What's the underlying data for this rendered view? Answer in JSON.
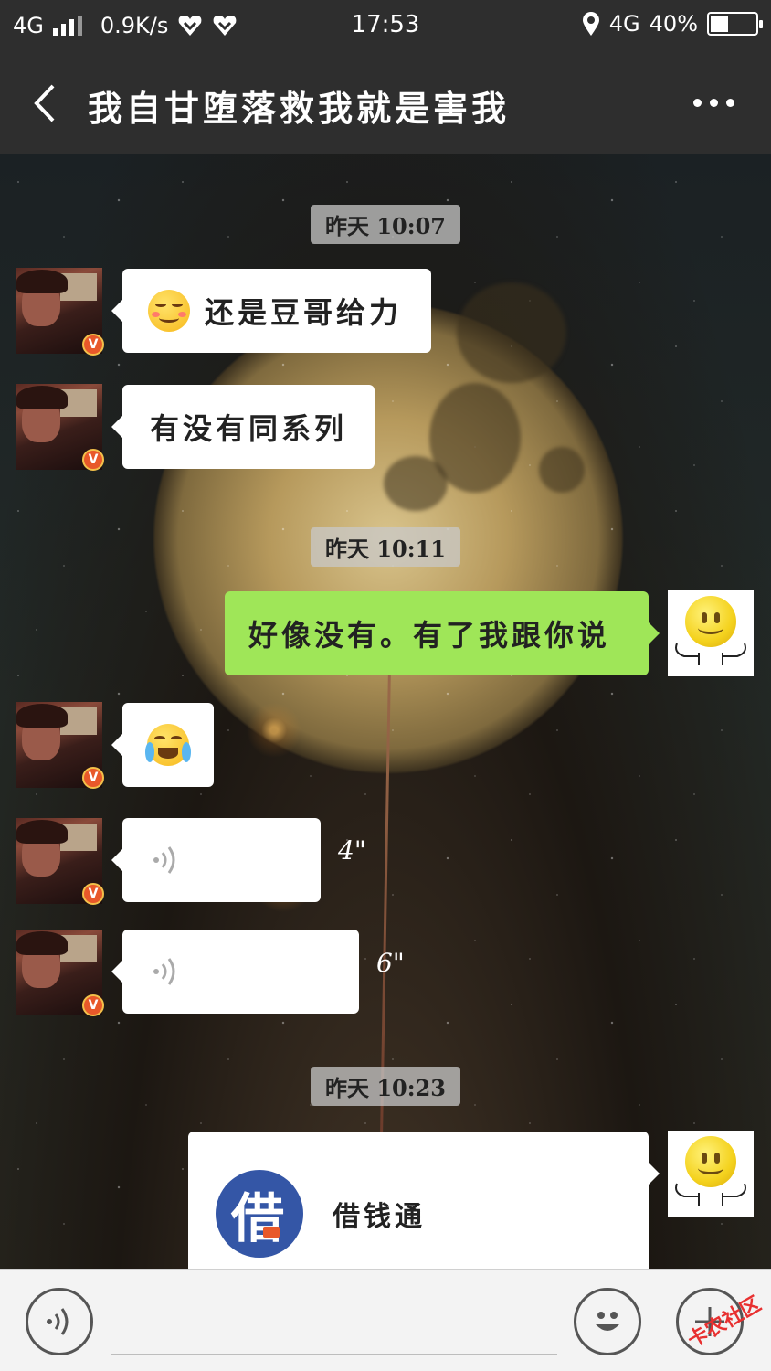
{
  "status_bar": {
    "network_left": "4G",
    "speed": "0.9K/s",
    "time": "17:53",
    "network_right": "4G",
    "battery": "40%",
    "battery_level": 0.4
  },
  "header": {
    "title": "我自甘堕落救我就是害我"
  },
  "messages": [
    {
      "type": "time",
      "text": "昨天 10:07"
    },
    {
      "type": "text",
      "side": "left",
      "emoji": "smiling-blush",
      "text": "还是豆哥给力"
    },
    {
      "type": "text",
      "side": "left",
      "text": "有没有同系列"
    },
    {
      "type": "time",
      "text": "昨天 10:11"
    },
    {
      "type": "text",
      "side": "right",
      "text": "好像没有。有了我跟你说"
    },
    {
      "type": "emoji",
      "side": "left",
      "emoji": "crying-laugh"
    },
    {
      "type": "voice",
      "side": "left",
      "duration": "4\""
    },
    {
      "type": "voice",
      "side": "left",
      "duration": "6\""
    },
    {
      "type": "time",
      "text": "昨天 10:23"
    },
    {
      "type": "card",
      "side": "right",
      "logo_text": "借",
      "title": "借钱通"
    }
  ],
  "badge_text": "V",
  "input_bar": {
    "voice_button": "voice-icon",
    "emoji_button": "emoji-icon",
    "plus_button": "plus-icon",
    "watermark": "卡农社区"
  },
  "colors": {
    "header_bg": "#2e2e2e",
    "self_bubble": "#9fe658",
    "other_bubble": "#ffffff",
    "card_logo": "#3456a6"
  }
}
